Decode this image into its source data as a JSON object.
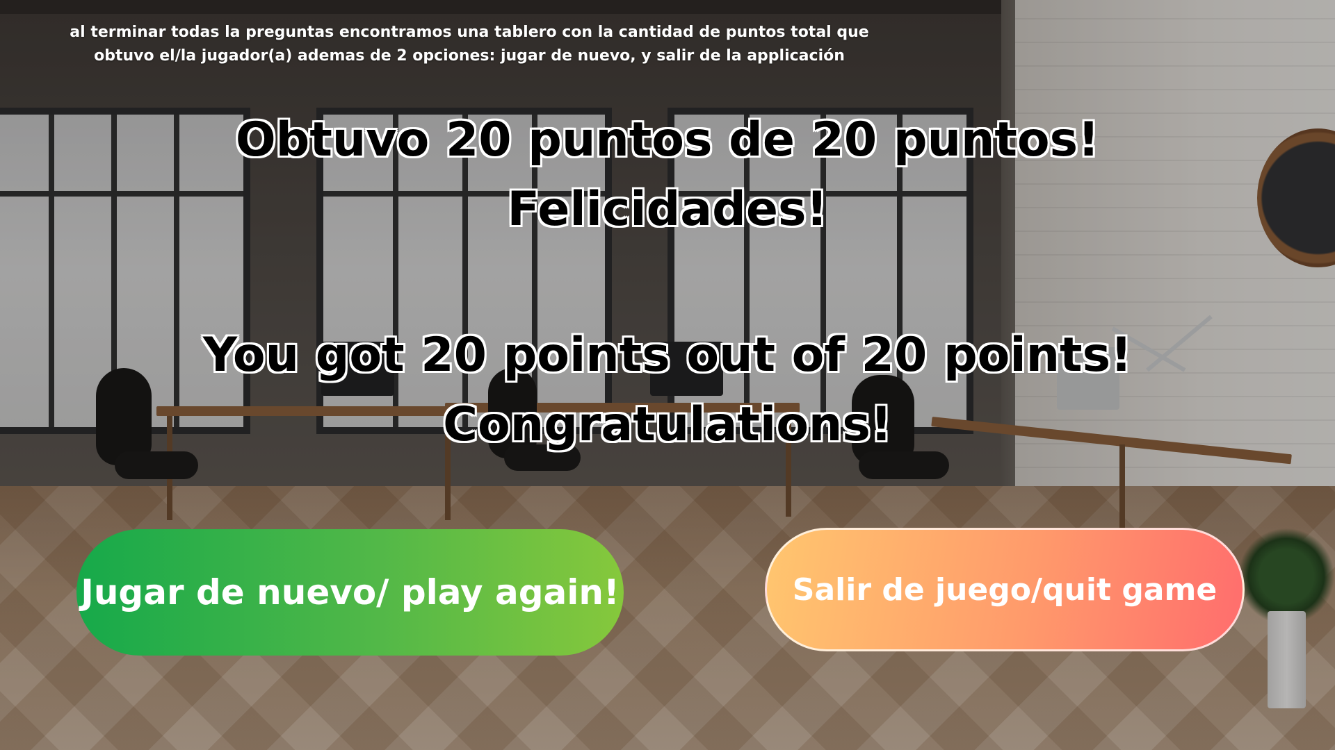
{
  "instruction_text": "al terminar todas la preguntas encontramos una tablero con la cantidad de puntos total que obtuvo el/la jugador(a) ademas de 2 opciones: jugar de nuevo, y salir de la applicación",
  "result": {
    "spanish_line1": "Obtuvo 20 puntos de 20 puntos!",
    "spanish_line2": "Felicidades!",
    "english_line1": "You got 20 points out of 20 points!",
    "english_line2": "Congratulations!"
  },
  "buttons": {
    "play_again_label": "Jugar de nuevo/ play again!",
    "quit_label": "Salir de juego/quit game"
  },
  "colors": {
    "play_again_gradient_start": "#16a94a",
    "play_again_gradient_end": "#86c83c",
    "quit_gradient_start": "#ffc66f",
    "quit_gradient_end": "#ff6d6d",
    "headline_text": "#000000",
    "headline_outline": "#ffffff"
  },
  "icons": {
    "background": "office-interior-image",
    "clock": "wall-clock-icon"
  }
}
